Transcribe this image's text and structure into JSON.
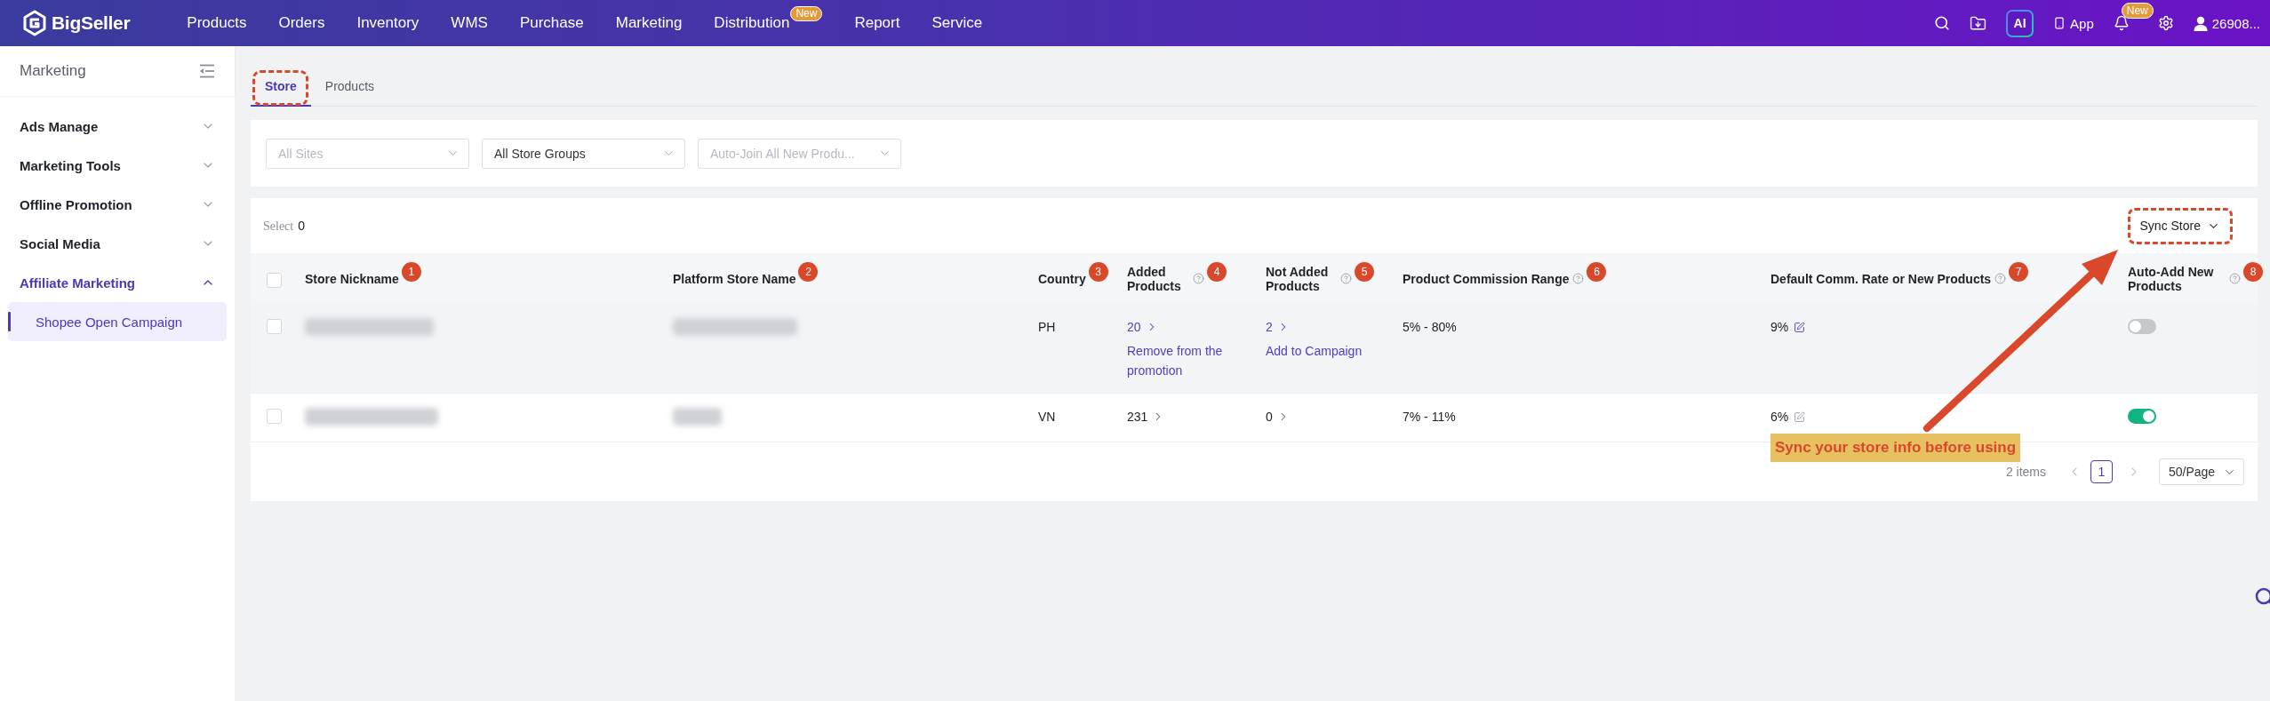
{
  "top_nav": {
    "logo": "BigSeller",
    "items": [
      {
        "label": "Products"
      },
      {
        "label": "Orders"
      },
      {
        "label": "Inventory"
      },
      {
        "label": "WMS"
      },
      {
        "label": "Purchase"
      },
      {
        "label": "Marketing"
      },
      {
        "label": "Distribution",
        "badge": "New"
      },
      {
        "label": "Report"
      },
      {
        "label": "Service"
      }
    ],
    "ai_button": "AI",
    "app_link": "App",
    "notification_badge": "New",
    "user": "26908..."
  },
  "sidebar": {
    "title": "Marketing",
    "groups": [
      {
        "label": "Ads Manage",
        "expanded": false
      },
      {
        "label": "Marketing Tools",
        "expanded": false
      },
      {
        "label": "Offline Promotion",
        "expanded": false
      },
      {
        "label": "Social Media",
        "expanded": false
      },
      {
        "label": "Affiliate Marketing",
        "expanded": true,
        "children": [
          {
            "label": "Shopee Open Campaign",
            "selected": true
          }
        ]
      }
    ]
  },
  "tabs": [
    {
      "label": "Store",
      "selected": true,
      "highlighted": true
    },
    {
      "label": "Products",
      "selected": false,
      "highlighted": false
    }
  ],
  "filters": [
    {
      "placeholder": "All Sites"
    },
    {
      "value": "All Store Groups"
    },
    {
      "placeholder": "Auto-Join All New Produ..."
    }
  ],
  "toolbar": {
    "select_label": "Select",
    "select_count": "0",
    "sync_button": "Sync Store",
    "sync_highlighted": true
  },
  "table": {
    "select_all": {
      "checked": false
    },
    "columns": [
      {
        "label": "Store Nickname",
        "help": false,
        "marker": "1"
      },
      {
        "label": "Platform Store Name",
        "help": false,
        "marker": "2"
      },
      {
        "label": "Country",
        "help": false,
        "marker": "3"
      },
      {
        "label": "Added Products",
        "help": true,
        "marker": "4"
      },
      {
        "label": "Not Added Products",
        "help": true,
        "marker": "5"
      },
      {
        "label": "Product Commission Range",
        "help": true,
        "marker": "6"
      },
      {
        "label": "Default Comm. Rate or New Products",
        "help": true,
        "marker": "7"
      },
      {
        "label": "Auto-Add New Products",
        "help": true,
        "marker": "8"
      }
    ],
    "rows": [
      {
        "checked": false,
        "hovered": true,
        "country": "PH",
        "added_products": "20",
        "added_action": "Remove from the promotion",
        "not_added_products": "2",
        "not_added_action": "Add to Campaign",
        "commission_range": "5% - 80%",
        "default_rate": "9%",
        "auto_add": false
      },
      {
        "checked": false,
        "hovered": false,
        "country": "VN",
        "added_products": "231",
        "not_added_products": "0",
        "commission_range": "7% - 11%",
        "default_rate": "6%",
        "auto_add": true
      }
    ]
  },
  "pagination": {
    "total": "2 items",
    "pages": [
      {
        "label": "1",
        "selected": true
      }
    ],
    "page_size": "50/Page"
  },
  "callout": {
    "text": "Sync your store info before using"
  }
}
